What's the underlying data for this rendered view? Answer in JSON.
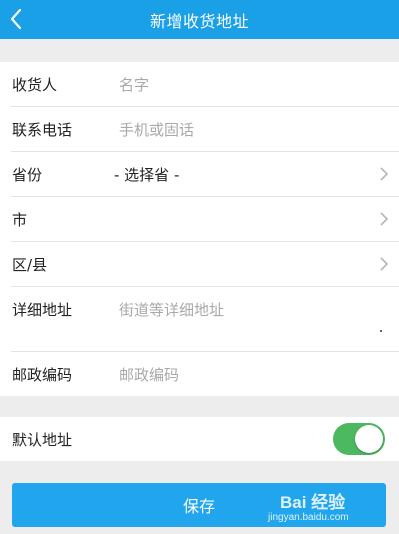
{
  "header": {
    "title": "新增收货地址"
  },
  "form": {
    "recipient": {
      "label": "收货人",
      "placeholder": "名字"
    },
    "phone": {
      "label": "联系电话",
      "placeholder": "手机或固话"
    },
    "province": {
      "label": "省份",
      "value": "- 选择省 -"
    },
    "city": {
      "label": "市"
    },
    "district": {
      "label": "区/县"
    },
    "address": {
      "label": "详细地址",
      "placeholder": "街道等详细地址"
    },
    "postcode": {
      "label": "邮政编码",
      "placeholder": "邮政编码"
    }
  },
  "default_address": {
    "label": "默认地址",
    "enabled": true
  },
  "actions": {
    "save_label": "保存"
  },
  "watermark": {
    "brand": "Bai 经验",
    "url": "jingyan.baidu.com"
  },
  "colors": {
    "header": "#19a0e6",
    "button": "#21a6ee",
    "toggle_on": "#4cb85f"
  }
}
